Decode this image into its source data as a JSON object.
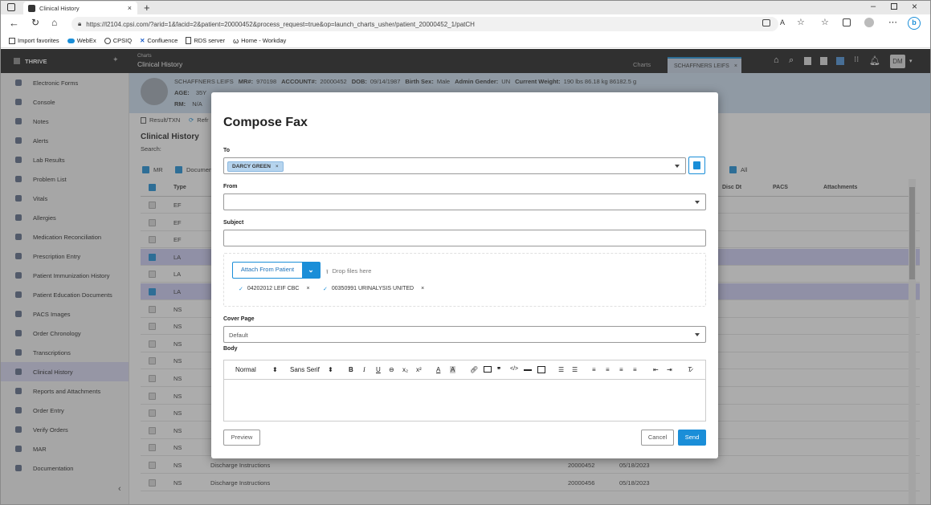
{
  "browser": {
    "tab_title": "Clinical History",
    "url": "https://l2104.cpsi.com/?arid=1&facid=2&patient=20000452&process_request=true&op=launch_charts_usher/patient_20000452_1/patCH",
    "bookmarks": [
      "Import favorites",
      "WebEx",
      "CPSIQ",
      "Confluence",
      "RDS server",
      "Home - Workday"
    ]
  },
  "app": {
    "logo": "THRIVE",
    "section_small": "Charts",
    "section_title": "Clinical History",
    "charts_tab": "Charts",
    "patient_tab": "SCHAFFNERS LEIFS",
    "user_initials": "DM"
  },
  "sidebar": {
    "items": [
      {
        "label": "Electronic Forms",
        "icon": "form-icon"
      },
      {
        "label": "Console",
        "icon": "console-icon"
      },
      {
        "label": "Notes",
        "icon": "notes-icon"
      },
      {
        "label": "Alerts",
        "icon": "alert-icon"
      },
      {
        "label": "Lab Results",
        "icon": "lab-icon"
      },
      {
        "label": "Problem List",
        "icon": "list-icon"
      },
      {
        "label": "Vitals",
        "icon": "vitals-icon"
      },
      {
        "label": "Allergies",
        "icon": "allergy-icon"
      },
      {
        "label": "Medication Reconciliation",
        "icon": "medication-icon"
      },
      {
        "label": "Prescription Entry",
        "icon": "prescription-icon"
      },
      {
        "label": "Patient Immunization History",
        "icon": "syringe-icon"
      },
      {
        "label": "Patient Education Documents",
        "icon": "education-icon"
      },
      {
        "label": "PACS Images",
        "icon": "image-icon"
      },
      {
        "label": "Order Chronology",
        "icon": "clock-icon"
      },
      {
        "label": "Transcriptions",
        "icon": "transcription-icon"
      },
      {
        "label": "Clinical History",
        "icon": "history-icon"
      },
      {
        "label": "Reports and Attachments",
        "icon": "attachment-icon"
      },
      {
        "label": "Order Entry",
        "icon": "order-icon"
      },
      {
        "label": "Verify Orders",
        "icon": "verify-icon"
      },
      {
        "label": "MAR",
        "icon": "mar-icon"
      },
      {
        "label": "Documentation",
        "icon": "documentation-icon"
      }
    ],
    "active_index": 15
  },
  "banner": {
    "line1": [
      {
        "k": "",
        "v": "SCHAFFNERS LEIFS"
      },
      {
        "k": "MR#:",
        "v": "970198"
      },
      {
        "k": "ACCOUNT#:",
        "v": "20000452"
      },
      {
        "k": "DOB:",
        "v": "09/14/1987"
      },
      {
        "k": "Birth Sex:",
        "v": "Male"
      },
      {
        "k": "Admin Gender:",
        "v": "UN"
      },
      {
        "k": "Current Weight:",
        "v": "190 lbs 86.18 kg 86182.5 g"
      }
    ],
    "line2_age_label": "AGE:",
    "line2_age": "35Y",
    "line3_rm_label": "RM:",
    "line3_rm": "N/A"
  },
  "toolbar": {
    "result_txn": "Result/TXN",
    "refresh": "Refr"
  },
  "page": {
    "title": "Clinical History",
    "search_label": "Search:",
    "filter_mr": "MR",
    "filter_documents": "Documen",
    "filter_all": "All"
  },
  "table": {
    "headers": {
      "type": "Type",
      "disc_dt": "Disc Dt",
      "pacs": "PACS",
      "attachments": "Attachments"
    },
    "rows": [
      {
        "type": "EF",
        "sel": false,
        "desc": "",
        "acct": "",
        "date": ""
      },
      {
        "type": "EF",
        "sel": false,
        "desc": "",
        "acct": "",
        "date": ""
      },
      {
        "type": "EF",
        "sel": false,
        "desc": "",
        "acct": "",
        "date": ""
      },
      {
        "type": "LA",
        "sel": true,
        "desc": "",
        "acct": "",
        "date": ""
      },
      {
        "type": "LA",
        "sel": false,
        "desc": "",
        "acct": "",
        "date": ""
      },
      {
        "type": "LA",
        "sel": true,
        "desc": "",
        "acct": "",
        "date": ""
      },
      {
        "type": "NS",
        "sel": false,
        "desc": "",
        "acct": "",
        "date": ""
      },
      {
        "type": "NS",
        "sel": false,
        "desc": "",
        "acct": "",
        "date": ""
      },
      {
        "type": "NS",
        "sel": false,
        "desc": "",
        "acct": "",
        "date": ""
      },
      {
        "type": "NS",
        "sel": false,
        "desc": "",
        "acct": "",
        "date": ""
      },
      {
        "type": "NS",
        "sel": false,
        "desc": "",
        "acct": "",
        "date": ""
      },
      {
        "type": "NS",
        "sel": false,
        "desc": "",
        "acct": "",
        "date": ""
      },
      {
        "type": "NS",
        "sel": false,
        "desc": "",
        "acct": "",
        "date": ""
      },
      {
        "type": "NS",
        "sel": false,
        "desc": "",
        "acct": "",
        "date": ""
      },
      {
        "type": "NS",
        "sel": false,
        "desc": "",
        "acct": "",
        "date": ""
      },
      {
        "type": "NS",
        "sel": false,
        "desc": "Discharge Instructions",
        "acct": "20000452",
        "date": "05/18/2023"
      },
      {
        "type": "NS",
        "sel": false,
        "desc": "Discharge Instructions",
        "acct": "20000456",
        "date": "05/18/2023"
      }
    ]
  },
  "modal": {
    "title": "Compose Fax",
    "to_label": "To",
    "to_chip": "DARCY GREEN",
    "from_label": "From",
    "subject_label": "Subject",
    "attach_button": "Attach From Patient",
    "drop_text": "Drop files here",
    "attachments": [
      "04202012 LEIF CBC",
      "00350991 URINALYSIS UNITED"
    ],
    "cover_label": "Cover Page",
    "cover_value": "Default",
    "body_label": "Body",
    "editor_format": "Normal",
    "editor_font": "Sans Serif",
    "preview": "Preview",
    "cancel": "Cancel",
    "send": "Send",
    "accent": "#1a8ed8"
  }
}
